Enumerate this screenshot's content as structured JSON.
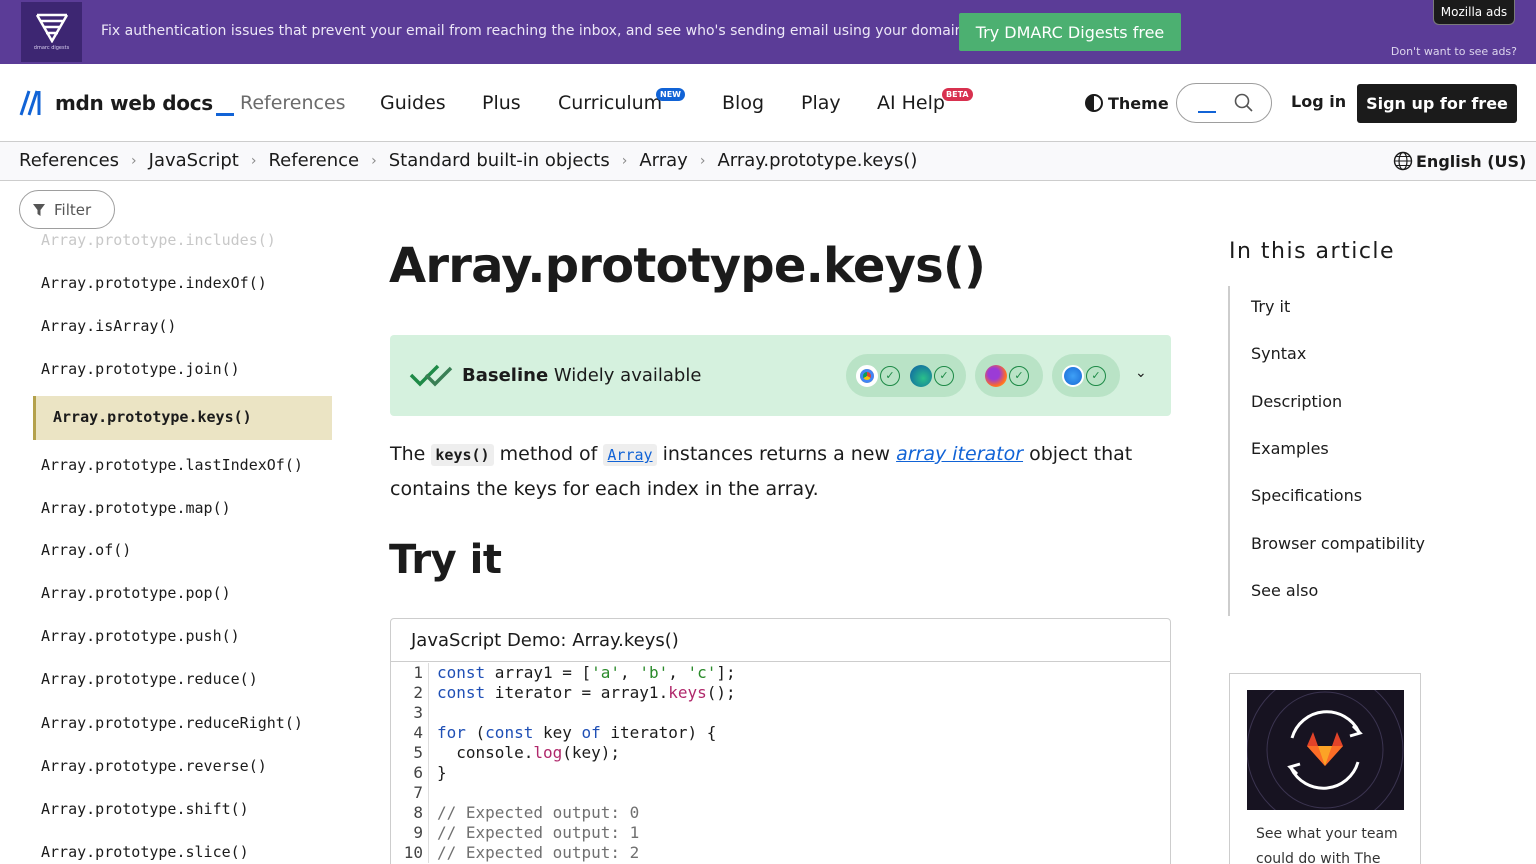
{
  "ad": {
    "logo_caption": "dmarc digests",
    "text": "Fix authentication issues that prevent your email from reaching the inbox, and see who's sending email using your domains.",
    "cta": "Try DMARC Digests free",
    "mozilla_ads": "Mozilla ads",
    "dont_want": "Don't want to see ads?"
  },
  "nav": {
    "logo_text": "mdn web docs",
    "items": [
      "References",
      "Guides",
      "Plus",
      "Curriculum",
      "Blog",
      "Play",
      "AI Help"
    ],
    "curriculum_badge": "NEW",
    "ai_badge": "BETA",
    "theme": "Theme",
    "login": "Log in",
    "signup": "Sign up for free"
  },
  "breadcrumb": [
    "References",
    "JavaScript",
    "Reference",
    "Standard built-in objects",
    "Array",
    "Array.prototype.keys()"
  ],
  "language": "English (US)",
  "sidebar": {
    "filter": "Filter",
    "faded_item": "Array.prototype.includes()",
    "items_before": [
      "Array.prototype.indexOf()",
      "Array.isArray()",
      "Array.prototype.join()"
    ],
    "active": "Array.prototype.keys()",
    "items_after": [
      "Array.prototype.lastIndexOf()",
      "Array.prototype.map()",
      "Array.of()",
      "Array.prototype.pop()",
      "Array.prototype.push()",
      "Array.prototype.reduce()",
      "Array.prototype.reduceRight()",
      "Array.prototype.reverse()",
      "Array.prototype.shift()",
      "Array.prototype.slice()"
    ]
  },
  "main": {
    "title": "Array.prototype.keys()",
    "baseline_bold": "Baseline",
    "baseline_status": "Widely available",
    "desc_the": "The",
    "desc_code": "keys()",
    "desc_method_of": "method of",
    "desc_array": "Array",
    "desc_mid": "instances returns a new",
    "desc_link": "array iterator",
    "desc_end": "object that contains the keys for each index in the array.",
    "try_it": "Try it",
    "demo_title": "JavaScript Demo: Array.keys()"
  },
  "code_lines": [
    "1",
    "2",
    "3",
    "4",
    "5",
    "6",
    "7",
    "8",
    "9",
    "10"
  ],
  "code": {
    "l1a": "const",
    "l1b": " array1 = [",
    "l1c": "'a'",
    "l1d": ", ",
    "l1e": "'b'",
    "l1f": ", ",
    "l1g": "'c'",
    "l1h": "];",
    "l2a": "const",
    "l2b": " iterator = array1.",
    "l2c": "keys",
    "l2d": "();",
    "l4a": "for",
    "l4b": " (",
    "l4c": "const",
    "l4d": " key ",
    "l4e": "of",
    "l4f": " iterator) {",
    "l5a": "  console.",
    "l5b": "log",
    "l5c": "(key);",
    "l6": "}",
    "l8": "// Expected output: 0",
    "l9": "// Expected output: 1",
    "l10": "// Expected output: 2"
  },
  "toc": {
    "title": "In this article",
    "items": [
      "Try it",
      "Syntax",
      "Description",
      "Examples",
      "Specifications",
      "Browser compatibility",
      "See also"
    ]
  },
  "side_ad": {
    "text": "See what your team could do with The"
  },
  "colors": {
    "ad_bg": "#5b3c97",
    "cta_green": "#4cb071",
    "link_blue": "#1163d6",
    "baseline_bg": "#d5f1de",
    "active_bg": "#ebe4c4",
    "new_badge": "#1163d6",
    "beta_badge": "#d8314f"
  }
}
